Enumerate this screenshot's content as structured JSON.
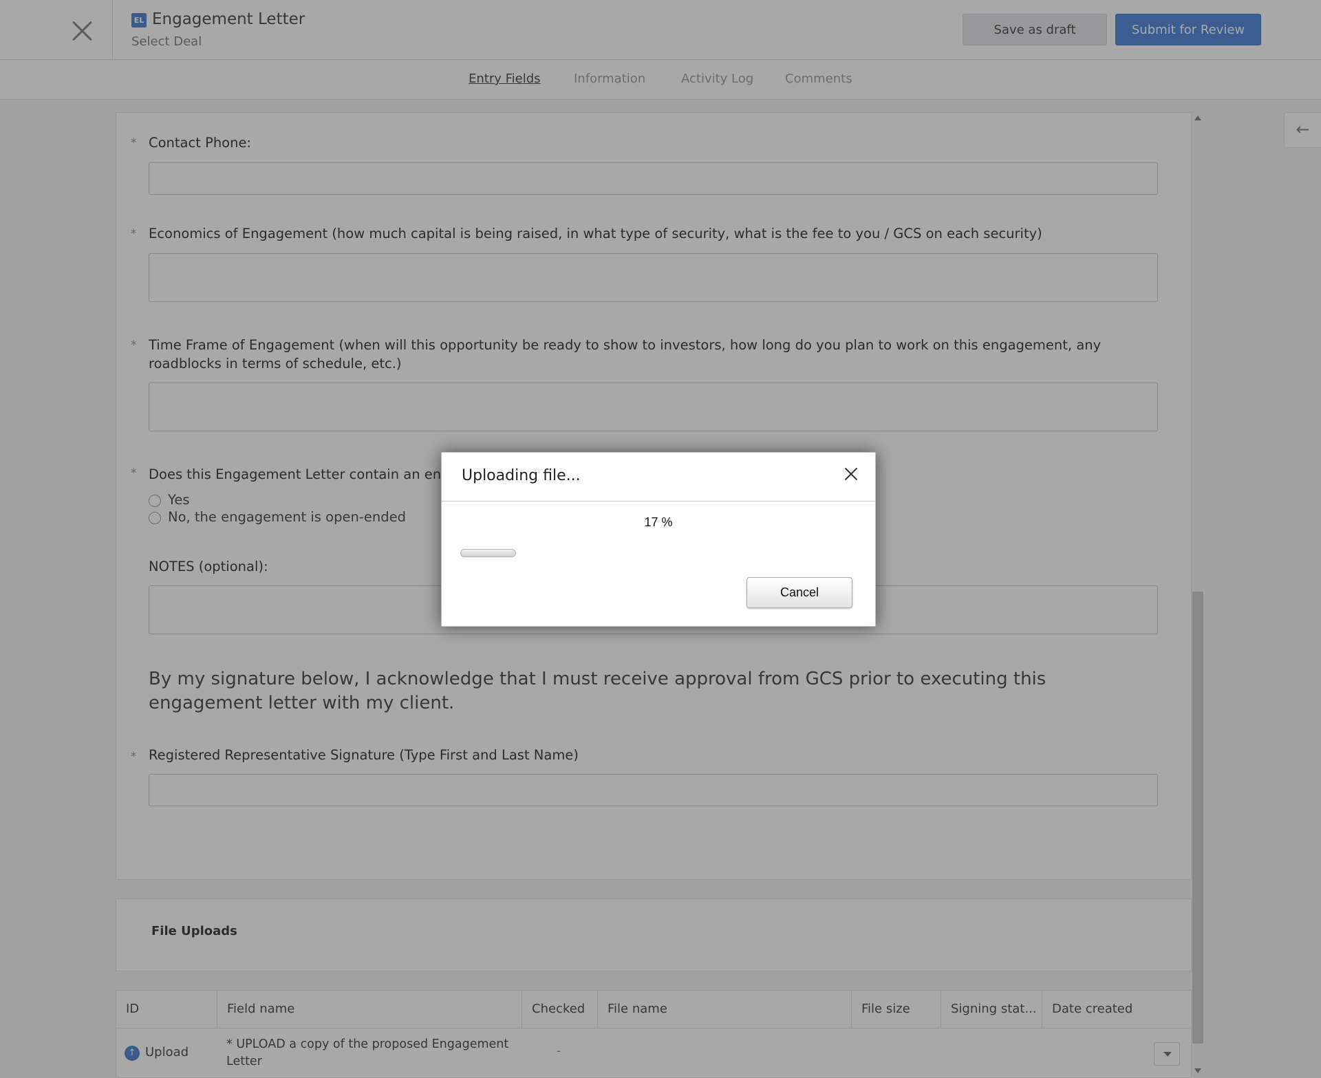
{
  "header": {
    "badge": "EL",
    "title": "Engagement Letter",
    "subtitle": "Select Deal",
    "save_draft_label": "Save as draft",
    "submit_label": "Submit for Review"
  },
  "tabs": [
    {
      "label": "Entry Fields",
      "active": true
    },
    {
      "label": "Information",
      "active": false
    },
    {
      "label": "Activity Log",
      "active": false
    },
    {
      "label": "Comments",
      "active": false
    }
  ],
  "form": {
    "required_marker": "*",
    "contact_phone": {
      "label": "Contact Phone:",
      "value": ""
    },
    "economics": {
      "label": "Economics of Engagement (how much capital is being raised, in what type of security, what is the fee to you / GCS on each security)",
      "value": ""
    },
    "time_frame": {
      "label": "Time Frame of Engagement (when will this opportunity be ready to show to investors, how long do you plan to work on this engagement, any roadblocks in terms of schedule, etc.)",
      "value": ""
    },
    "end_date": {
      "label": "Does this Engagement Letter contain an end (e",
      "options": [
        "Yes",
        "No, the engagement is open-ended"
      ]
    },
    "notes": {
      "label": "NOTES (optional):",
      "value": ""
    },
    "acknowledgement": "By my signature below, I acknowledge that I must receive approval from GCS prior to executing this engagement letter with my client.",
    "signature": {
      "label": "Registered Representative Signature (Type First and Last Name)",
      "value": ""
    }
  },
  "file_uploads": {
    "title": "File Uploads",
    "columns": [
      "ID",
      "Field name",
      "Checked",
      "File name",
      "File size",
      "Signing stat...",
      "Date created"
    ],
    "rows": [
      {
        "id_action": "Upload",
        "field_name": "* UPLOAD a copy of the proposed Engagement Letter",
        "checked": "-"
      }
    ]
  },
  "side_tab_arrow": "←",
  "dialog": {
    "title": "Uploading file...",
    "percent_text": "17 %",
    "progress": 0.14,
    "cancel_label": "Cancel"
  },
  "icons": {
    "close": "close-icon",
    "upload": "upload-icon",
    "dropdown": "chevron-down-icon",
    "side_arrow": "arrow-left-icon"
  },
  "colors": {
    "accent": "#5a8bd6",
    "submit_button": "#5b8ede"
  }
}
